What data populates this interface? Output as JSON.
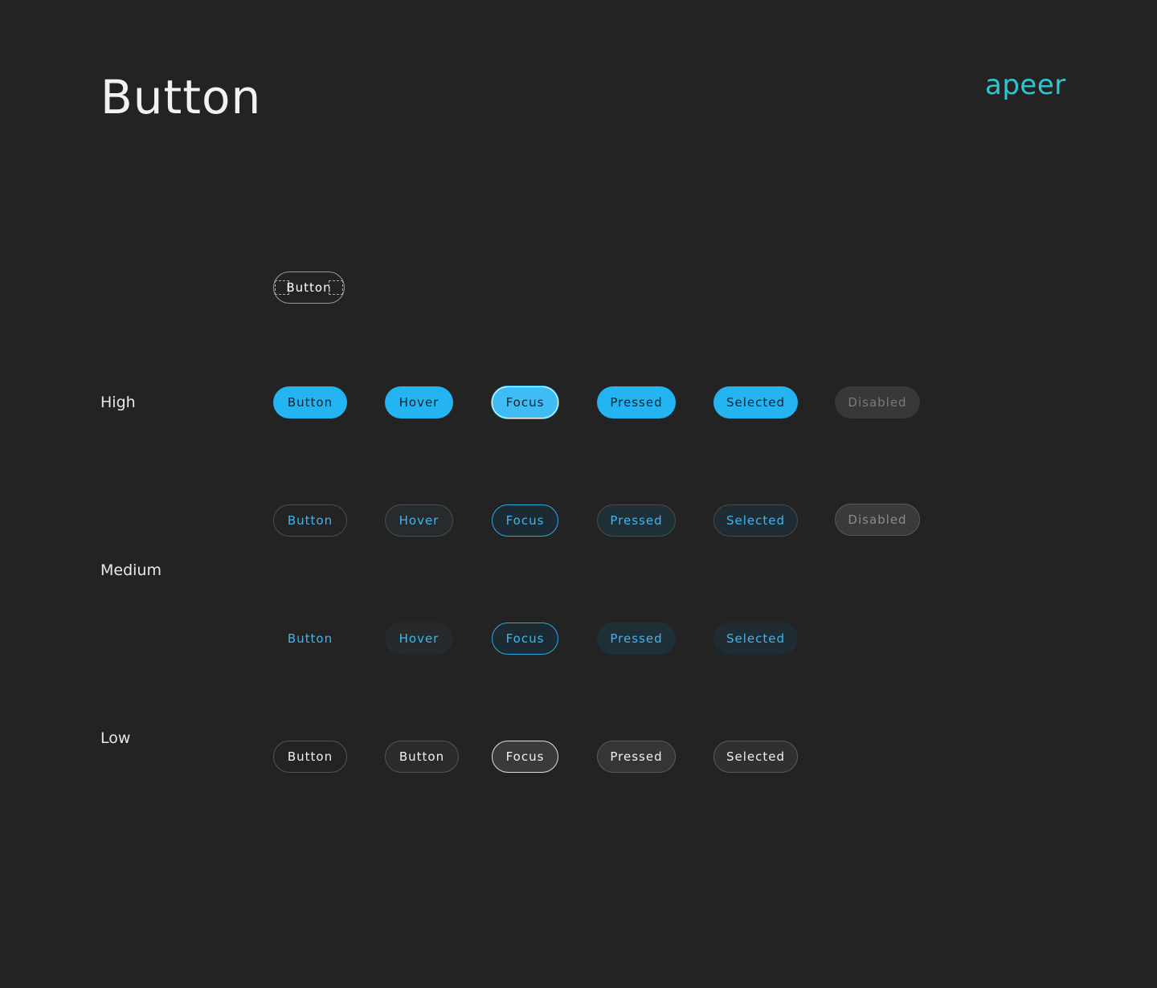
{
  "header": {
    "title": "Button",
    "logo": "apeer"
  },
  "colors": {
    "background": "#232323",
    "primary": "#24b4f2",
    "logo": "#2fc6d4"
  },
  "anatomy": {
    "label": "Button"
  },
  "rows": {
    "high": "High",
    "medium": "Medium",
    "low": "Low"
  },
  "high": {
    "button": "Button",
    "hover": "Hover",
    "focus": "Focus",
    "pressed": "Pressed",
    "selected": "Selected",
    "disabled": "Disabled"
  },
  "medium_outline": {
    "button": "Button",
    "hover": "Hover",
    "focus": "Focus",
    "pressed": "Pressed",
    "selected": "Selected",
    "disabled": "Disabled"
  },
  "medium_flat": {
    "button": "Button",
    "hover": "Hover",
    "focus": "Focus",
    "pressed": "Pressed",
    "selected": "Selected"
  },
  "low": {
    "button": "Button",
    "hover": "Button",
    "focus": "Focus",
    "pressed": "Pressed",
    "selected": "Selected"
  }
}
